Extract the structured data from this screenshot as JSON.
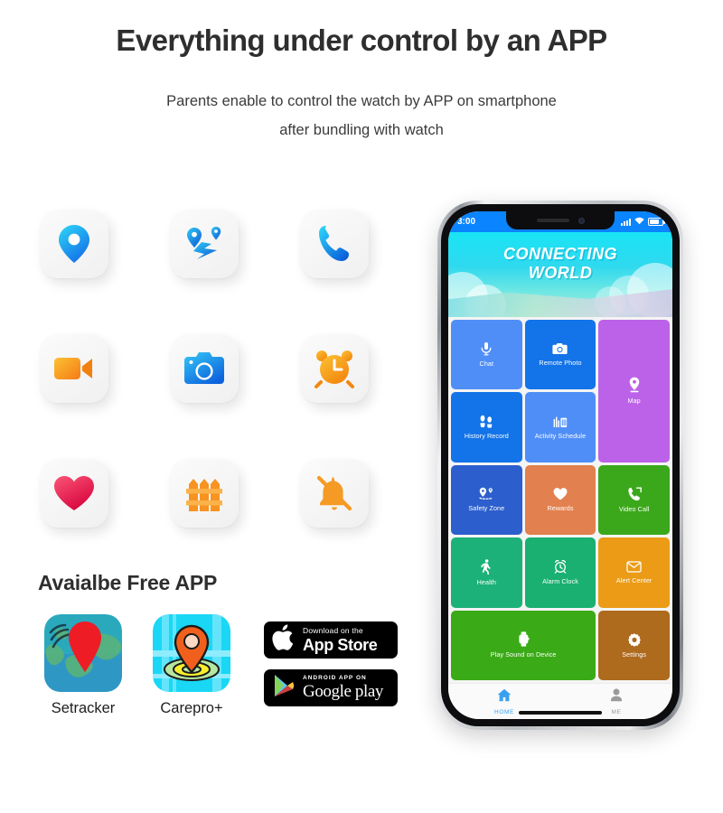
{
  "header": {
    "headline": "Everything under control by an APP",
    "subline_1": "Parents enable to control the watch by APP on smartphone",
    "subline_2": "after bundling with watch"
  },
  "feature_icons": [
    {
      "name": "location-pin-icon",
      "label": "Location",
      "color": "#21bdf5"
    },
    {
      "name": "route-map-icon",
      "label": "Route tracking",
      "color": "#1f9df0"
    },
    {
      "name": "phone-call-icon",
      "label": "Phone call",
      "color": "#22c3f7"
    },
    {
      "name": "video-camera-icon",
      "label": "Video call",
      "color": "#f5a623"
    },
    {
      "name": "camera-icon",
      "label": "Remote photo",
      "color": "#1a9cf0"
    },
    {
      "name": "alarm-clock-icon",
      "label": "Alarm clock",
      "color": "#f89a1c"
    },
    {
      "name": "heart-icon",
      "label": "Health",
      "color": "#ef2f57"
    },
    {
      "name": "fence-icon",
      "label": "Safety zone",
      "color": "#f79320"
    },
    {
      "name": "bell-off-icon",
      "label": "Do not disturb",
      "color": "#f59a24"
    }
  ],
  "free_app": {
    "title": "Avaialbe Free APP",
    "apps": [
      {
        "name": "setracker",
        "label": "Setracker"
      },
      {
        "name": "carepro",
        "label": "Carepro+"
      }
    ],
    "store_badges": [
      {
        "name": "app-store-badge",
        "small": "Download on the",
        "big": "App Store"
      },
      {
        "name": "google-play-badge",
        "small": "ANDROID APP ON",
        "big": "Google play"
      }
    ]
  },
  "phone": {
    "status_bar": {
      "time": "3:00"
    },
    "banner": {
      "line1": "CONNECTING",
      "line2": "WORLD"
    },
    "tiles": [
      {
        "label": "Chat",
        "icon": "microphone-icon",
        "color": "#4f8ef7"
      },
      {
        "label": "Remote Photo",
        "icon": "camera-icon",
        "color": "#1373e8"
      },
      {
        "label": "Map",
        "icon": "map-pin-icon",
        "color": "#bc62e8"
      },
      {
        "label": "History Record",
        "icon": "footprints-icon",
        "color": "#1373e8"
      },
      {
        "label": "Activity Schedule",
        "icon": "bar-chart-icon",
        "color": "#4f8ef7"
      },
      {
        "label": "Safety Zone",
        "icon": "geofence-pin-icon",
        "color": "#2c5fcd"
      },
      {
        "label": "Rewards",
        "icon": "heart-icon",
        "color": "#e2804f"
      },
      {
        "label": "Video Call",
        "icon": "video-phone-icon",
        "color": "#3aa81a"
      },
      {
        "label": "Health",
        "icon": "walking-icon",
        "color": "#1cb178"
      },
      {
        "label": "Alarm Clock",
        "icon": "alarm-clock-icon",
        "color": "#19b071"
      },
      {
        "label": "Alert Center",
        "icon": "envelope-icon",
        "color": "#eb9b16"
      },
      {
        "label": "Play Sound on Device",
        "icon": "watch-icon",
        "color": "#3aaa16"
      },
      {
        "label": "Settings",
        "icon": "gear-icon",
        "color": "#ae6a1d"
      }
    ],
    "tabs": [
      {
        "label": "HOME",
        "icon": "home-icon",
        "active": true
      },
      {
        "label": "ME",
        "icon": "person-icon",
        "active": false
      }
    ]
  }
}
